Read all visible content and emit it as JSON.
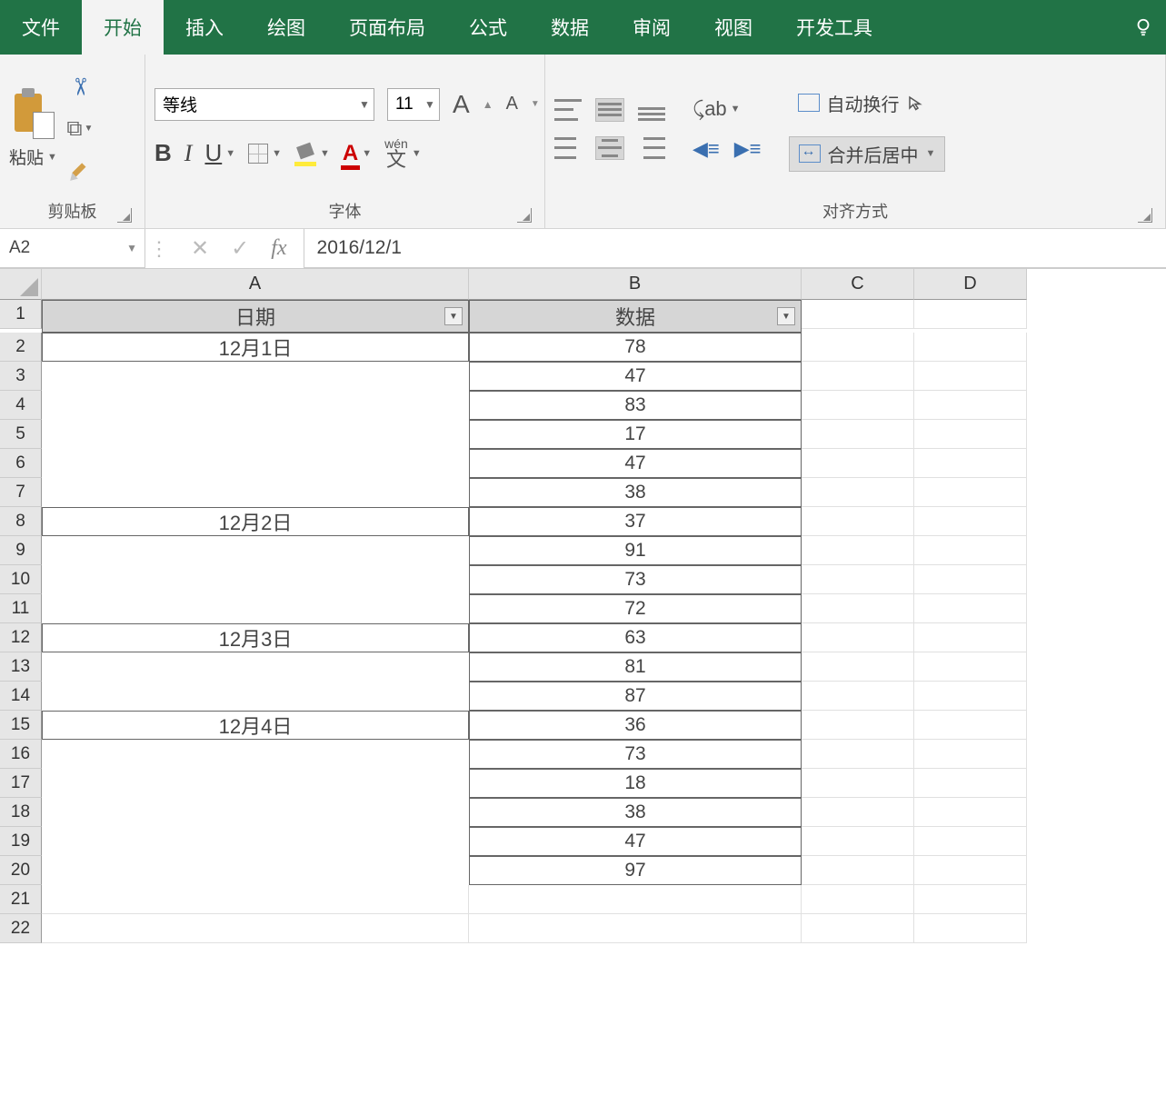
{
  "tabs": {
    "file": "文件",
    "home": "开始",
    "insert": "插入",
    "draw": "绘图",
    "layout": "页面布局",
    "formula": "公式",
    "data": "数据",
    "review": "审阅",
    "view": "视图",
    "dev": "开发工具"
  },
  "ribbon": {
    "clipboard": {
      "label": "剪贴板",
      "paste": "粘贴"
    },
    "font": {
      "label": "字体",
      "name": "等线",
      "size": "11",
      "phonetic_top": "wén",
      "phonetic_char": "文",
      "grow": "A",
      "shrink": "A",
      "bold": "B",
      "italic": "I",
      "underline": "U",
      "color_letter": "A"
    },
    "align": {
      "label": "对齐方式",
      "wrap": "自动换行",
      "merge": "合并后居中"
    }
  },
  "namebox": "A2",
  "formula": "2016/12/1",
  "columns": [
    "A",
    "B",
    "C",
    "D"
  ],
  "row_numbers": [
    1,
    2,
    3,
    4,
    5,
    6,
    7,
    8,
    9,
    10,
    11,
    12,
    13,
    14,
    15,
    16,
    17,
    18,
    19,
    20,
    21,
    22
  ],
  "headers": {
    "date": "日期",
    "data": "数据"
  },
  "groups": [
    {
      "label": "12月1日",
      "rows": [
        2,
        3,
        4,
        5,
        6,
        7
      ],
      "values": [
        78,
        47,
        83,
        17,
        47,
        38
      ]
    },
    {
      "label": "12月2日",
      "rows": [
        8,
        9,
        10,
        11
      ],
      "values": [
        37,
        91,
        73,
        72
      ]
    },
    {
      "label": "12月3日",
      "rows": [
        12,
        13,
        14
      ],
      "values": [
        63,
        81,
        87
      ]
    },
    {
      "label": "12月4日",
      "rows": [
        15,
        16,
        17,
        18,
        19,
        20
      ],
      "values": [
        36,
        73,
        18,
        38,
        47,
        97
      ]
    }
  ],
  "empty_rows": [
    21,
    22
  ]
}
